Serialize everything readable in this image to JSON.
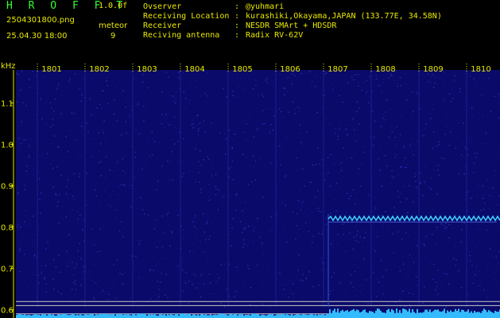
{
  "header": {
    "app_title": "H R O F F T",
    "version": "1.0.0f",
    "file_name": "2504301800.png",
    "date_time": "25.04.30 18:00",
    "mode_label": "meteor",
    "mode_value": "9",
    "info": [
      {
        "label": "Ovserver",
        "sep": ":",
        "value": "@yuhmari"
      },
      {
        "label": "Receiving Location",
        "sep": ":",
        "value": "kurashiki,Okayama,JAPAN (133.77E, 34.58N)"
      },
      {
        "label": "Receiver",
        "sep": ":",
        "value": "NESDR SMArt + HDSDR"
      },
      {
        "label": "Reciving antenna",
        "sep": ":",
        "value": "Radix RV-62V"
      }
    ]
  },
  "colors": {
    "background": "#000000",
    "waterfall": "#0a0a6a",
    "text": "#e8e800",
    "title": "#33ff33",
    "signal": "#3fd0ff"
  },
  "chart_data": {
    "type": "heatmap",
    "ylabel": "kHz",
    "y_unit": "kHz",
    "ylim": [
      0.58,
      1.18
    ],
    "x_categories": [
      "1801",
      "1802",
      "1803",
      "1804",
      "1805",
      "1806",
      "1807",
      "1808",
      "1809",
      "1810"
    ],
    "y_ticks": [
      "1.1",
      "1.0",
      "0.9",
      "0.8",
      "0.7",
      "0.6"
    ],
    "y_tick_values": [
      1.1,
      1.0,
      0.9,
      0.8,
      0.7,
      0.6
    ],
    "signal": {
      "start_minute": 1806.8,
      "end_minute": 1811.0,
      "freq_khz": 0.82
    },
    "reference_lines_khz": [
      0.62,
      0.61,
      0.59
    ]
  }
}
